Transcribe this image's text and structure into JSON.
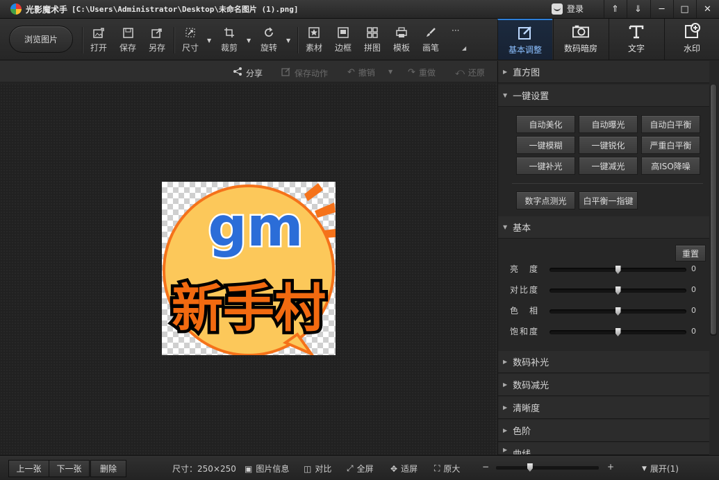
{
  "window": {
    "app_name": "光影魔术手",
    "file_path": "[C:\\Users\\Administrator\\Desktop\\未命名图片 (1).png]",
    "login": "登录"
  },
  "toolbar": {
    "browse": "浏览图片",
    "open": "打开",
    "save": "保存",
    "save_as": "另存",
    "size": "尺寸",
    "crop": "裁剪",
    "rotate": "旋转",
    "material": "素材",
    "border": "边框",
    "collage": "拼图",
    "template": "模板",
    "brush": "画笔",
    "more": "···"
  },
  "right_tabs": {
    "basic": "基本调整",
    "darkroom": "数码暗房",
    "text": "文字",
    "watermark": "水印"
  },
  "subbar": {
    "share": "分享",
    "save_action": "保存动作",
    "undo": "撤销",
    "redo": "重做",
    "restore": "还原"
  },
  "image_content": {
    "line1": "gm",
    "line2": "新手村",
    "colors": {
      "circle": "#fcc85a",
      "gm": "#2b6dd8",
      "text": "#f26a10",
      "ray": "#f5721a"
    }
  },
  "panel": {
    "histogram": "直方图",
    "one_click": "一键设置",
    "buttons": [
      [
        "自动美化",
        "自动曝光",
        "自动白平衡"
      ],
      [
        "一键模糊",
        "一键锐化",
        "严重白平衡"
      ],
      [
        "一键补光",
        "一键减光",
        "高ISO降噪"
      ]
    ],
    "extra_buttons": [
      "数字点测光",
      "白平衡一指键"
    ],
    "basic": "基本",
    "reset": "重置",
    "sliders": [
      {
        "label": "亮　度",
        "value": "0",
        "level": 0.5
      },
      {
        "label": "对比度",
        "value": "0",
        "level": 0.5
      },
      {
        "label": "色　相",
        "value": "0",
        "level": 0.5
      },
      {
        "label": "饱和度",
        "value": "0",
        "level": 0.5
      }
    ],
    "fill_light": "数码补光",
    "reduce_light": "数码减光",
    "sharpness": "清晰度",
    "levels": "色阶",
    "curves": "曲线"
  },
  "statusbar": {
    "prev": "上一张",
    "next": "下一张",
    "delete": "删除",
    "size_info": "尺寸：250×250",
    "image_info": "图片信息",
    "compare": "对比",
    "fullscreen": "全屏",
    "fit": "适屏",
    "original": "原大",
    "zoom_minus": "−",
    "zoom_plus": "+",
    "zoom_level": 0.33,
    "expand": "展开(1)"
  }
}
